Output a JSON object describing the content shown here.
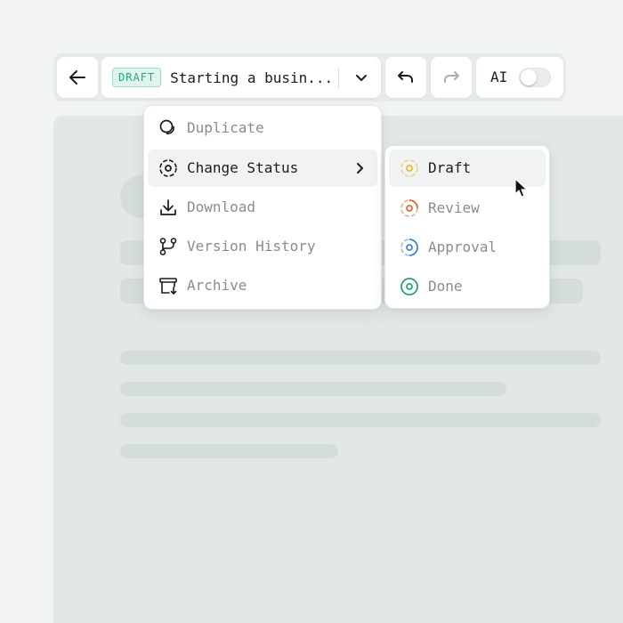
{
  "toolbar": {
    "back_icon": "arrow-left-icon",
    "status_badge": "DRAFT",
    "doc_title": "Starting a busin...",
    "dropdown_icon": "chevron-down-icon",
    "undo_icon": "undo-icon",
    "redo_icon": "redo-icon",
    "ai_label": "AI",
    "ai_toggle_on": false
  },
  "menu": {
    "items": [
      {
        "label": "Duplicate",
        "icon": "duplicate-icon",
        "active": false
      },
      {
        "label": "Change Status",
        "icon": "status-icon",
        "active": true,
        "has_submenu": true
      },
      {
        "label": "Download",
        "icon": "download-icon",
        "active": false
      },
      {
        "label": "Version History",
        "icon": "branch-icon",
        "active": false
      },
      {
        "label": "Archive",
        "icon": "archive-icon",
        "active": false
      }
    ]
  },
  "submenu": {
    "items": [
      {
        "label": "Draft",
        "icon": "status-draft-icon",
        "color": "#e8b93a",
        "active": true
      },
      {
        "label": "Review",
        "icon": "status-review-icon",
        "color": "#d2703f",
        "active": false
      },
      {
        "label": "Approval",
        "icon": "status-approval-icon",
        "color": "#3f86c8",
        "active": false
      },
      {
        "label": "Done",
        "icon": "status-done-icon",
        "color": "#27a37e",
        "active": false
      }
    ]
  },
  "colors": {
    "accent_green": "#2aa684",
    "text_primary": "#1b1d1c",
    "text_muted": "#8a8d8c"
  }
}
